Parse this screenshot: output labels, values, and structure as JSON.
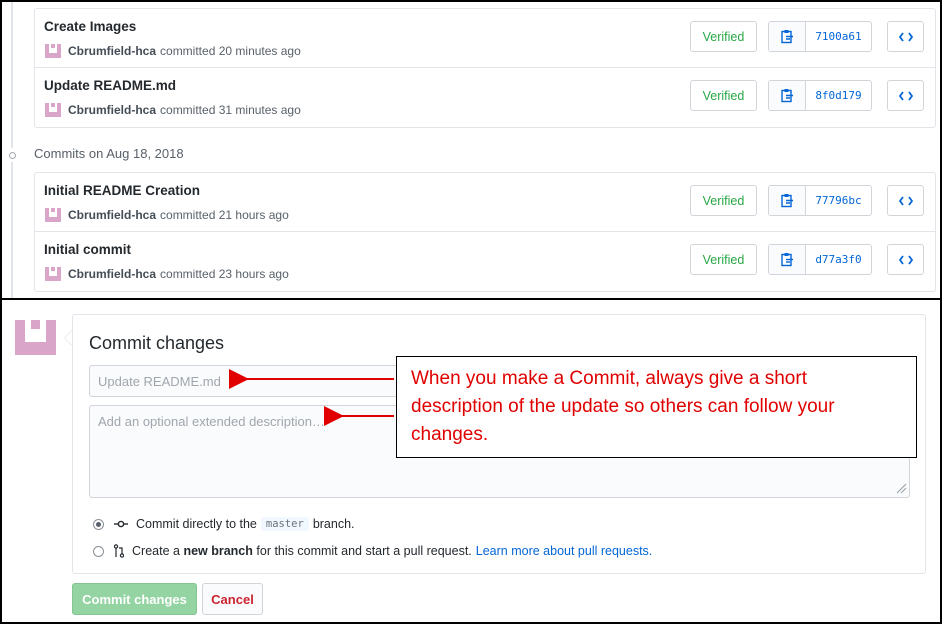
{
  "date_header": "Commits on Aug 18, 2018",
  "group1": [
    {
      "title": "Create Images",
      "author": "Cbrumfield-hca",
      "action": "committed",
      "time": "20 minutes ago",
      "verified": "Verified",
      "sha": "7100a61"
    },
    {
      "title": "Update README.md",
      "author": "Cbrumfield-hca",
      "action": "committed",
      "time": "31 minutes ago",
      "verified": "Verified",
      "sha": "8f0d179"
    }
  ],
  "group2": [
    {
      "title": "Initial README Creation",
      "author": "Cbrumfield-hca",
      "action": "committed",
      "time": "21 hours ago",
      "verified": "Verified",
      "sha": "77796bc"
    },
    {
      "title": "Initial commit",
      "author": "Cbrumfield-hca",
      "action": "committed",
      "time": "23 hours ago",
      "verified": "Verified",
      "sha": "d77a3f0"
    }
  ],
  "commit_form": {
    "title": "Commit changes",
    "summary_placeholder": "Update README.md",
    "description_placeholder": "Add an optional extended description…",
    "option_direct": {
      "prefix": "Commit directly to the",
      "branch": "master",
      "suffix": "branch."
    },
    "option_new_branch": {
      "prefix": "Create a",
      "bold": "new branch",
      "suffix": "for this commit and start a pull request.",
      "link": "Learn more about pull requests."
    },
    "commit_button": "Commit changes",
    "cancel_button": "Cancel"
  },
  "callout": {
    "text": "When you make a Commit, always give a short description of the update so others can follow your changes."
  },
  "colors": {
    "verified": "#28a745",
    "sha": "#0366d6",
    "callout_text": "#e00000",
    "commit_btn": "#94d3a2",
    "cancel_text": "#cb2431"
  }
}
